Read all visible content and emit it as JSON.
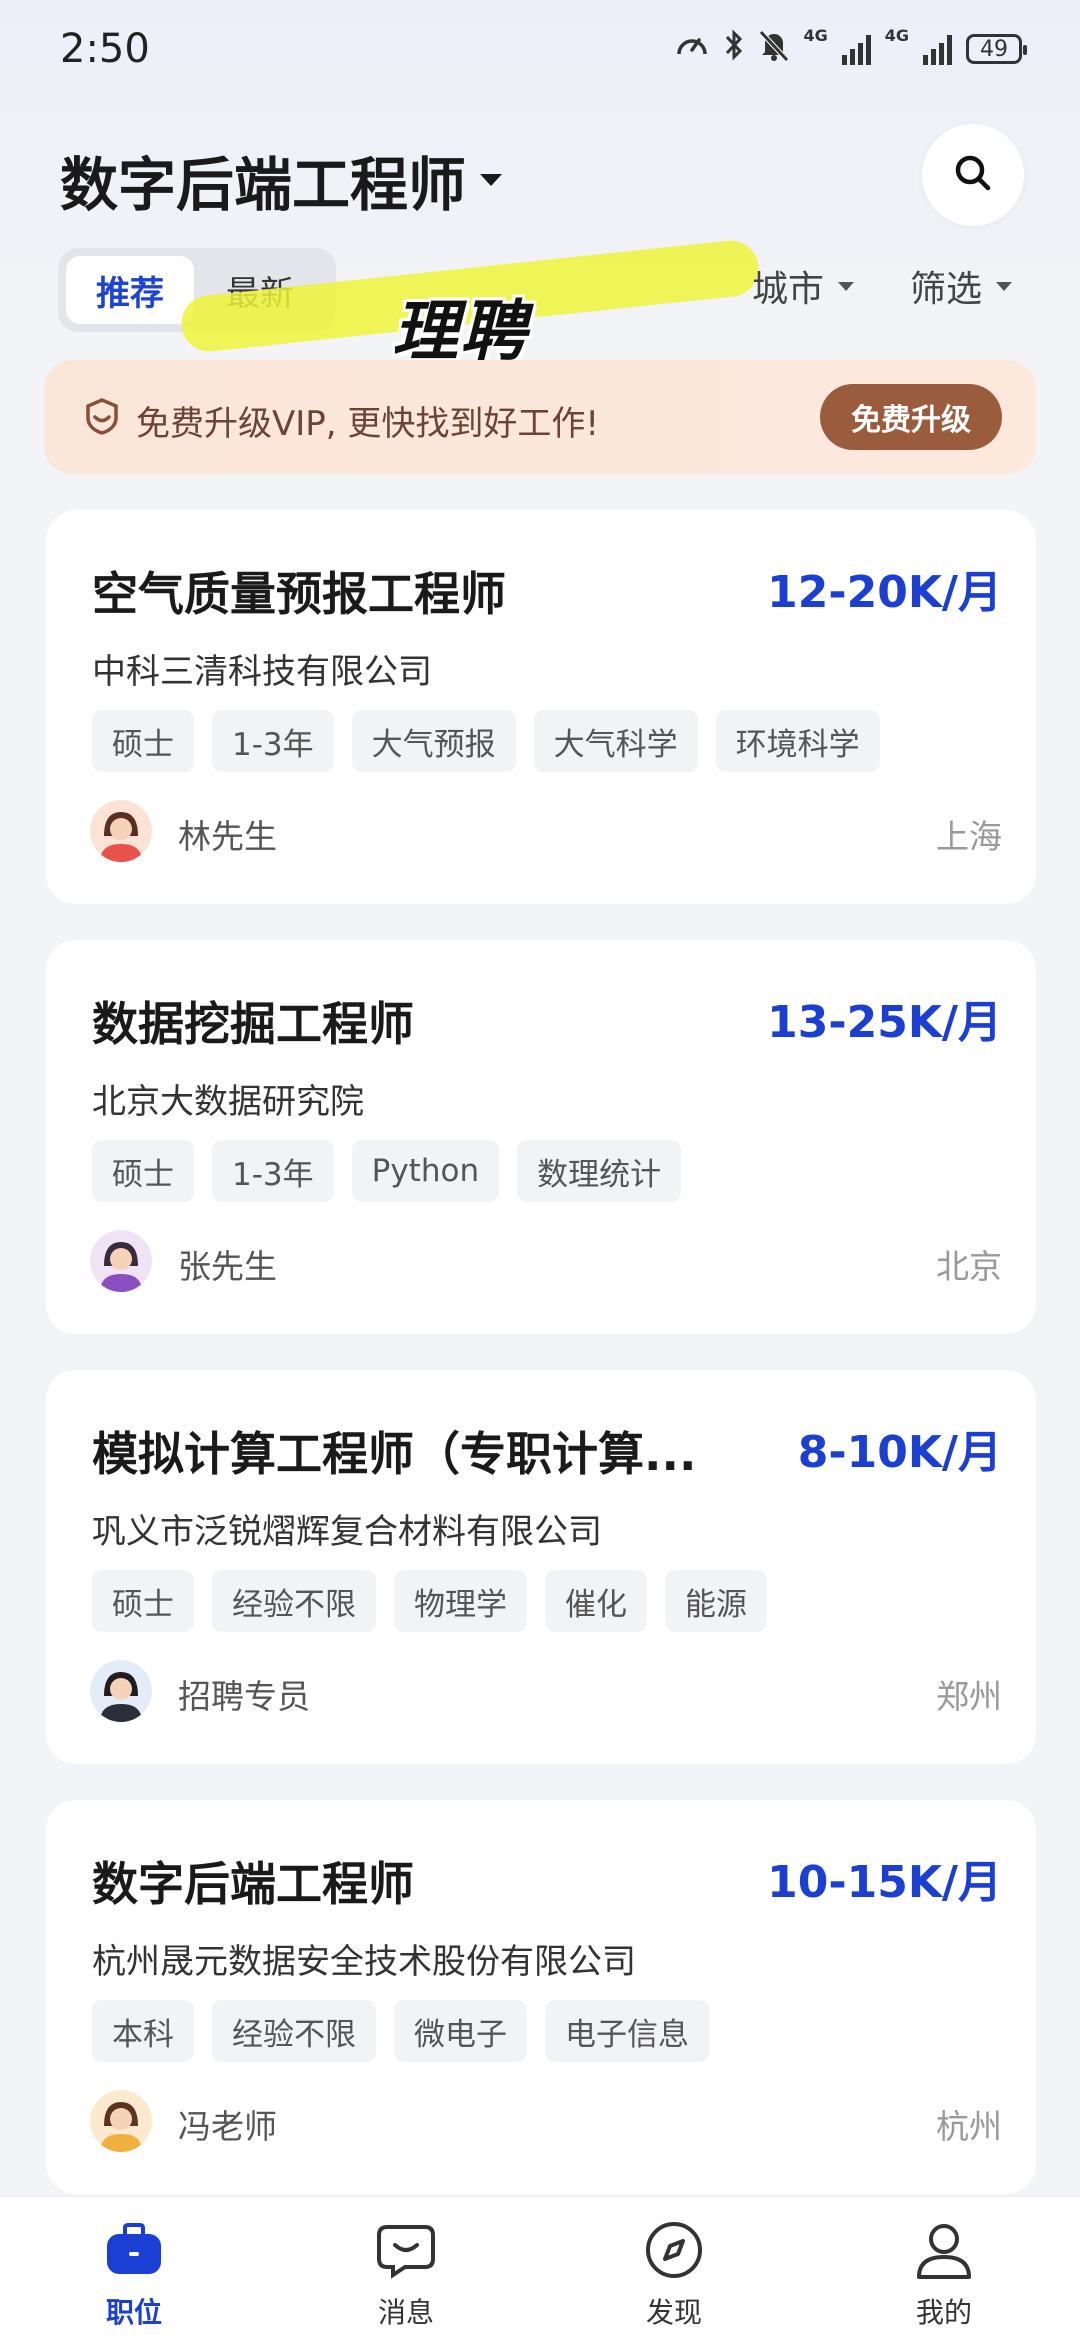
{
  "status_bar": {
    "time": "2:50",
    "network_1": "4G",
    "network_2": "4G",
    "battery": "49"
  },
  "header": {
    "title": "数字后端工程师"
  },
  "tabs": [
    {
      "label": "推荐",
      "active": true
    },
    {
      "label": "最新",
      "active": false
    }
  ],
  "filters": {
    "city": "城市",
    "filter": "筛选"
  },
  "overlay_sticker": "理聘",
  "vip_banner": {
    "text": "免费升级VIP, 更快找到好工作!",
    "button": "免费升级"
  },
  "jobs": [
    {
      "title": "空气质量预报工程师",
      "salary": "12-20K/月",
      "company": "中科三清科技有限公司",
      "tags": [
        "硕士",
        "1-3年",
        "大气预报",
        "大气科学",
        "环境科学"
      ],
      "recruiter": "林先生",
      "city": "上海",
      "avatar": "female-avatar-icon"
    },
    {
      "title": "数据挖掘工程师",
      "salary": "13-25K/月",
      "company": "北京大数据研究院",
      "tags": [
        "硕士",
        "1-3年",
        "Python",
        "数理统计"
      ],
      "recruiter": "张先生",
      "city": "北京",
      "avatar": "female-avatar-icon"
    },
    {
      "title": "模拟计算工程师（专职计算...",
      "salary": "8-10K/月",
      "company": "巩义市泛锐熠辉复合材料有限公司",
      "tags": [
        "硕士",
        "经验不限",
        "物理学",
        "催化",
        "能源"
      ],
      "recruiter": "招聘专员",
      "city": "郑州",
      "avatar": "male-avatar-icon"
    },
    {
      "title": "数字后端工程师",
      "salary": "10-15K/月",
      "company": "杭州晟元数据安全技术股份有限公司",
      "tags": [
        "本科",
        "经验不限",
        "微电子",
        "电子信息"
      ],
      "recruiter": "冯老师",
      "city": "杭州",
      "avatar": "female-avatar-icon"
    }
  ],
  "bottom_nav": [
    {
      "label": "职位",
      "icon": "briefcase-icon",
      "active": true
    },
    {
      "label": "消息",
      "icon": "message-icon",
      "active": false
    },
    {
      "label": "发现",
      "icon": "compass-icon",
      "active": false
    },
    {
      "label": "我的",
      "icon": "profile-icon",
      "active": false
    }
  ],
  "colors": {
    "accent": "#1a3fd2",
    "vip_button": "#9b5b3d",
    "vip_bg": "#fbe6da"
  }
}
